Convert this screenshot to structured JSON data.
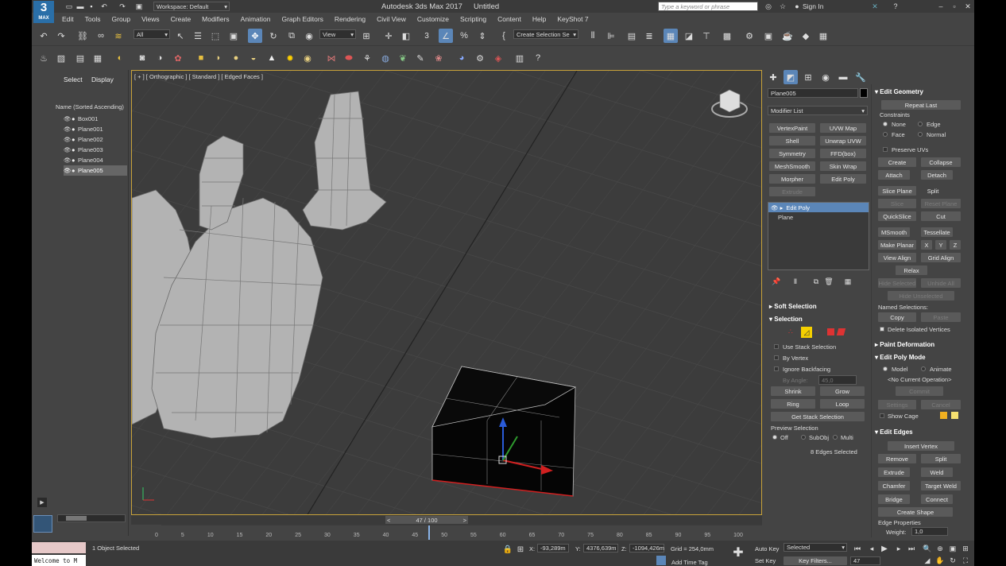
{
  "app": {
    "logo_top": "3",
    "logo_bottom": "MAX",
    "title": "Autodesk 3ds Max 2017",
    "doc": "Untitled",
    "workspace": "Workspace: Default",
    "search_placeholder": "Type a keyword or phrase",
    "sign_in": "Sign In"
  },
  "menu": [
    "Edit",
    "Tools",
    "Group",
    "Views",
    "Create",
    "Modifiers",
    "Animation",
    "Graph Editors",
    "Rendering",
    "Civil View",
    "Customize",
    "Scripting",
    "Content",
    "Help",
    "KeyShot 7"
  ],
  "toolbar": {
    "filter": "All",
    "ref_coord": "View",
    "selset": "Create Selection Se"
  },
  "scene": {
    "tab_select": "Select",
    "tab_display": "Display",
    "sort_label": "Name (Sorted Ascending)",
    "items": [
      "Box001",
      "Plane001",
      "Plane002",
      "Plane003",
      "Plane004",
      "Plane005"
    ]
  },
  "viewport": {
    "label": "[ + ] [ Orthographic ] [ Standard ] [ Edged Faces ]"
  },
  "command": {
    "object_name": "Plane005",
    "modifier_list": "Modifier List",
    "mod_buttons": [
      "VertexPaint",
      "UVW Map",
      "Shell",
      "Unwrap UVW",
      "Symmetry",
      "FFD(box)",
      "MeshSmooth",
      "Skin Wrap",
      "Morpher",
      "Edit Poly",
      "Extrude"
    ],
    "stack": [
      "Edit Poly",
      "Plane"
    ]
  },
  "soft_selection": {
    "title": "Soft Selection"
  },
  "selection": {
    "title": "Selection",
    "use_stack": "Use Stack Selection",
    "by_vertex": "By Vertex",
    "ignore_backfacing": "Ignore Backfacing",
    "by_angle": "By Angle:",
    "angle": "45,0",
    "shrink": "Shrink",
    "grow": "Grow",
    "ring": "Ring",
    "loop": "Loop",
    "get_stack": "Get Stack Selection",
    "preview": "Preview Selection",
    "off": "Off",
    "subobj": "SubObj",
    "multi": "Multi",
    "status": "8 Edges Selected"
  },
  "edit_geometry": {
    "title": "Edit Geometry",
    "repeat_last": "Repeat Last",
    "constraints": "Constraints",
    "none": "None",
    "edge": "Edge",
    "face": "Face",
    "normal": "Normal",
    "preserve_uvs": "Preserve UVs",
    "create": "Create",
    "collapse": "Collapse",
    "attach": "Attach",
    "detach": "Detach",
    "slice_plane": "Slice Plane",
    "split": "Split",
    "slice": "Slice",
    "reset_plane": "Reset Plane",
    "quickslice": "QuickSlice",
    "cut": "Cut",
    "msmooth": "MSmooth",
    "tessellate": "Tessellate",
    "make_planar": "Make Planar",
    "x": "X",
    "y": "Y",
    "z": "Z",
    "view_align": "View Align",
    "grid_align": "Grid Align",
    "relax": "Relax",
    "hide_selected": "Hide Selected",
    "unhide_all": "Unhide All",
    "hide_unselected": "Hide Unselected",
    "named_sel": "Named Selections:",
    "copy": "Copy",
    "paste": "Paste",
    "delete_iso": "Delete Isolated Vertices"
  },
  "paint_def": {
    "title": "Paint Deformation"
  },
  "edit_poly_mode": {
    "title": "Edit Poly Mode",
    "model": "Model",
    "animate": "Animate",
    "no_op": "<No Current Operation>",
    "commit": "Commit",
    "settings": "Settings",
    "cancel": "Cancel",
    "show_cage": "Show Cage"
  },
  "edit_edges": {
    "title": "Edit Edges",
    "insert_vertex": "Insert Vertex",
    "remove": "Remove",
    "split": "Split",
    "extrude": "Extrude",
    "weld": "Weld",
    "chamfer": "Chamfer",
    "target_weld": "Target Weld",
    "bridge": "Bridge",
    "connect": "Connect",
    "create_shape": "Create Shape",
    "edge_props": "Edge Properties",
    "weight_label": "Weight:",
    "weight": "1,0"
  },
  "timeline": {
    "frame": "47 / 100",
    "ticks": [
      "0",
      "5",
      "10",
      "15",
      "20",
      "25",
      "30",
      "35",
      "40",
      "45",
      "50",
      "55",
      "60",
      "65",
      "70",
      "75",
      "80",
      "85",
      "90",
      "95",
      "100"
    ]
  },
  "status": {
    "objects": "1 Object Selected",
    "welcome": "Welcome to M",
    "x": "-93,289m",
    "y": "4376,639m",
    "z": "-1094,426m",
    "grid": "Grid = 254,0mm",
    "add_time_tag": "Add Time Tag",
    "auto_key": "Auto Key",
    "selected": "Selected",
    "set_key": "Set Key",
    "key_filters": "Key Filters...",
    "cur_frame": "47"
  },
  "colors": {
    "accent": "#f5d000",
    "viewport_bg": "#3c3c3c",
    "viewport_border": "#c8a23a"
  }
}
